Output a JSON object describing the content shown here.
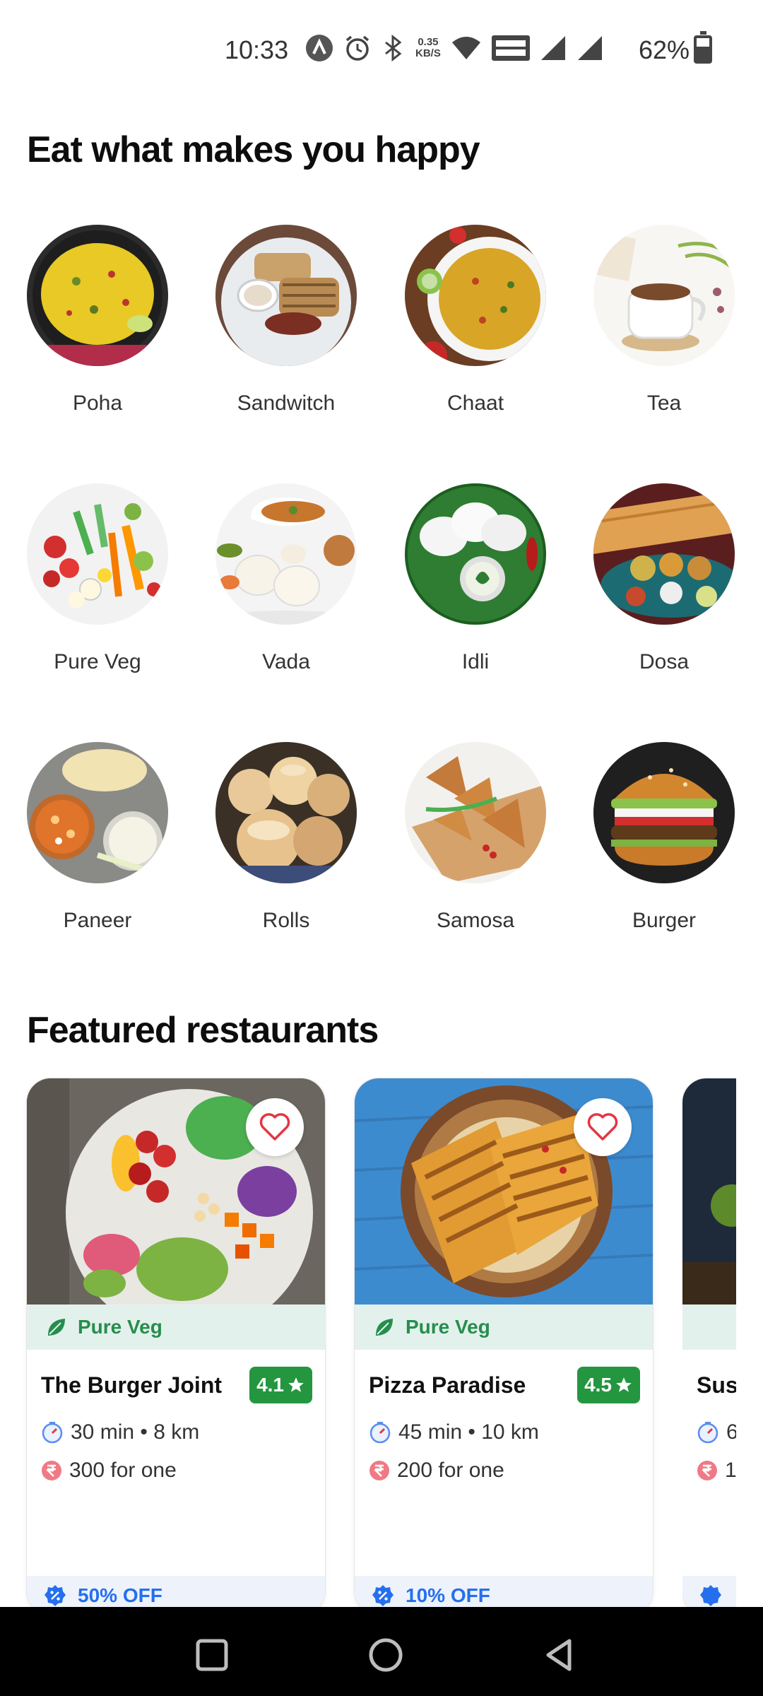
{
  "status_bar": {
    "time": "10:33",
    "net_speed_value": "0.35",
    "net_speed_unit": "KB/S",
    "battery": "62%"
  },
  "sections": {
    "categories_title": "Eat what makes you happy",
    "featured_title": "Featured restaurants"
  },
  "categories": [
    {
      "label": "Poha"
    },
    {
      "label": "Sandwitch"
    },
    {
      "label": "Chaat"
    },
    {
      "label": "Tea"
    },
    {
      "label": "Pure Veg"
    },
    {
      "label": "Vada"
    },
    {
      "label": "Idli"
    },
    {
      "label": "Dosa"
    },
    {
      "label": "Paneer"
    },
    {
      "label": "Rolls"
    },
    {
      "label": "Samosa"
    },
    {
      "label": "Burger"
    }
  ],
  "restaurants": [
    {
      "name": "The Burger Joint",
      "rating": "4.1",
      "tag": "Pure Veg",
      "time_distance": "30 min • 8 km",
      "price": "300 for one",
      "offer": "50% OFF"
    },
    {
      "name": "Pizza Paradise",
      "rating": "4.5",
      "tag": "Pure Veg",
      "time_distance": "45 min • 10 km",
      "price": "200 for one",
      "offer": "10% OFF"
    },
    {
      "name": "Sus",
      "time_distance": "6",
      "price": "1("
    }
  ],
  "colors": {
    "rating_green": "#24963f",
    "veg_green": "#268e4d",
    "offer_blue": "#256fef",
    "heart_red": "#e23744"
  }
}
